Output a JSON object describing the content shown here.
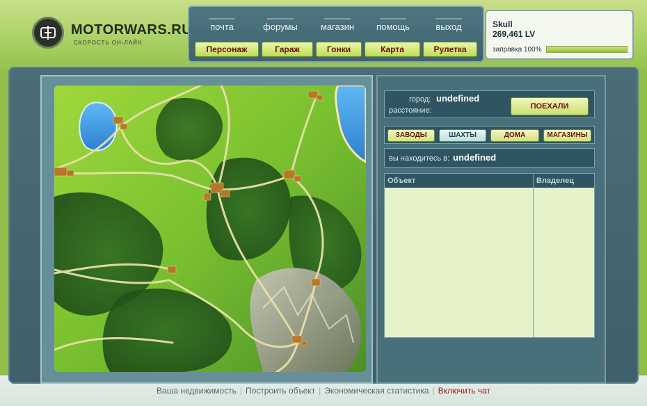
{
  "brand": {
    "name": "MOTORWARS.RU",
    "tagline": "СКОРОСТЬ ОН-ЛАЙН"
  },
  "top_links": [
    "почта",
    "форумы",
    "магазин",
    "помощь",
    "выход"
  ],
  "nav_buttons": [
    "Персонаж",
    "Гараж",
    "Гонки",
    "Карта",
    "Рулетка"
  ],
  "user": {
    "name": "Skull",
    "balance": "269,461 LV",
    "fuel_label": "заправка 100%",
    "fuel_value": 1.0
  },
  "city": {
    "city_label": "город:",
    "city_value": "undefined",
    "distance_label": "расстояние:",
    "go_button": "ПОЕХАЛИ"
  },
  "categories": [
    "ЗАВОДЫ",
    "ШАХТЫ",
    "ДОМА",
    "МАГАЗИНЫ"
  ],
  "location": {
    "label": "вы находитесь в:",
    "value": "undefined"
  },
  "table": {
    "col_object": "Объект",
    "col_owner": "Владелец"
  },
  "footer": [
    "Ваша недвижимость",
    "Построить объект",
    "Экономическая статистика",
    "Включить чат"
  ],
  "colors": {
    "accent": "#6a1010",
    "nav_bg": "#3e636e",
    "button_green": "#bedc56"
  }
}
